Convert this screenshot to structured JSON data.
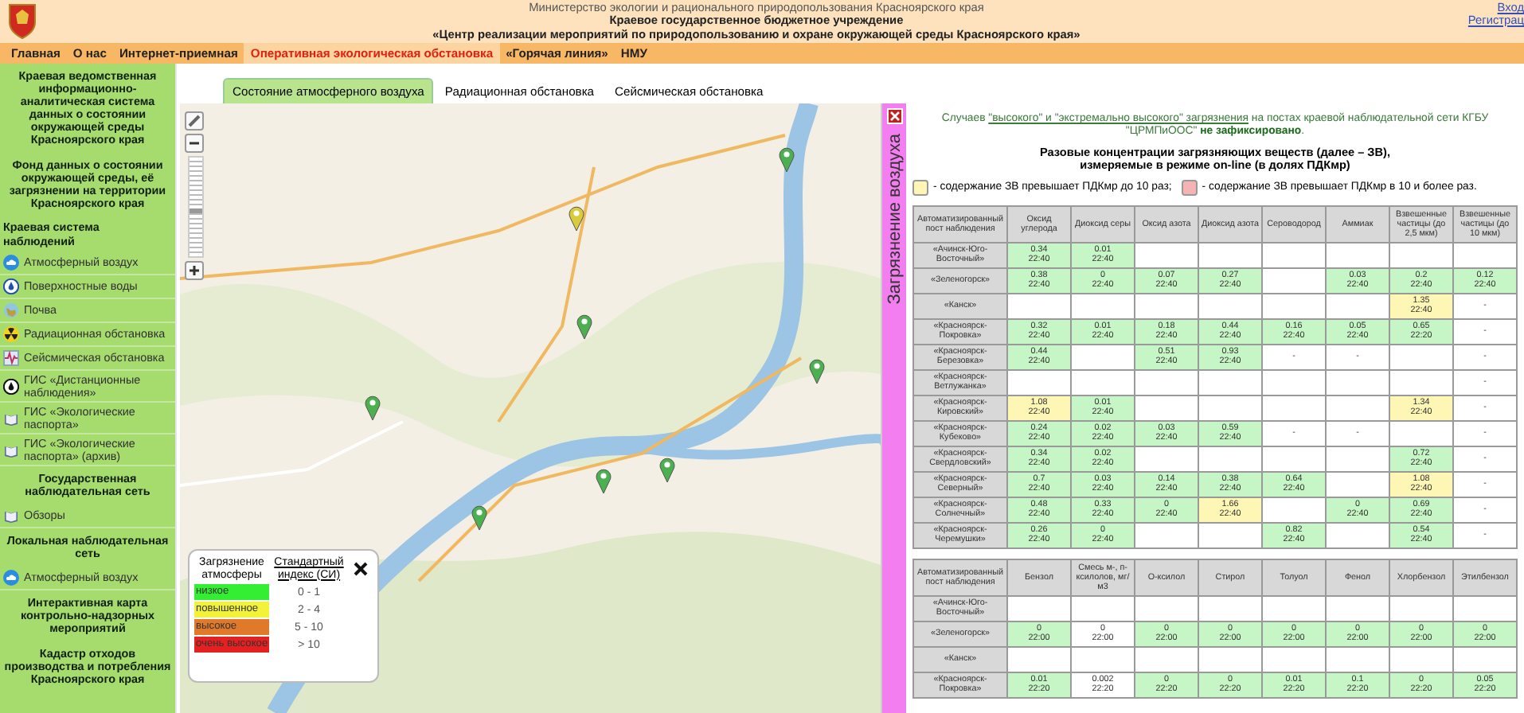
{
  "header": {
    "lines": [
      "Министерство экологии и рационального природопользования Красноярского края",
      "Краевое государственное бюджетное учреждение",
      "«Центр реализации мероприятий по природопользованию и охране окружающей среды Красноярского края»"
    ],
    "auth_links": [
      "Вход",
      "Регистрац"
    ]
  },
  "nav": [
    {
      "label": "Главная",
      "selected": false
    },
    {
      "label": "О нас",
      "selected": false
    },
    {
      "label": "Интернет-приемная",
      "selected": false
    },
    {
      "label": "Оперативная экологическая обстановка",
      "selected": true
    },
    {
      "label": "«Горячая линия»",
      "selected": false
    },
    {
      "label": "НМУ",
      "selected": false
    }
  ],
  "sidebar": [
    {
      "kind": "block",
      "text": "Краевая ведомственная информационно-аналитическая система данных о состоянии окружающей среды Красноярского края"
    },
    {
      "kind": "block",
      "text": "Фонд данных о состоянии окружающей среды, её загрязнении на территории Красноярского края"
    },
    {
      "kind": "group",
      "text": "Краевая система наблюдений"
    },
    {
      "kind": "link",
      "text": "Атмосферный воздух"
    },
    {
      "kind": "link",
      "text": "Поверхностные воды"
    },
    {
      "kind": "link",
      "text": "Почва"
    },
    {
      "kind": "link",
      "text": "Радиационная обстановка"
    },
    {
      "kind": "link",
      "text": "Сейсмическая обстановка"
    },
    {
      "kind": "link",
      "text": "ГИС «Дистанционные наблюдения»"
    },
    {
      "kind": "link",
      "text": "ГИС «Экологические паспорта»"
    },
    {
      "kind": "link",
      "text": "ГИС «Экологические паспорта» (архив)"
    },
    {
      "kind": "block",
      "text": "Государственная наблюдательная сеть"
    },
    {
      "kind": "link",
      "text": "Обзоры"
    },
    {
      "kind": "block",
      "text": "Локальная наблюдательная сеть"
    },
    {
      "kind": "link",
      "text": "Атмосферный воздух"
    },
    {
      "kind": "block",
      "text": "Интерактивная карта контрольно-надзорных мероприятий"
    },
    {
      "kind": "block",
      "text": "Кадастр отходов производства и потребления Красноярского края"
    }
  ],
  "tabs": [
    {
      "label": "Состояние атмосферного воздуха",
      "selected": true
    },
    {
      "label": "Радиационная обстановка",
      "selected": false
    },
    {
      "label": "Сейсмическая обстановка",
      "selected": false
    }
  ],
  "map": {
    "zoom": {
      "level": 0.45
    },
    "markers": [
      {
        "color": "#4caf50"
      },
      {
        "color": "#d8cc3c"
      },
      {
        "color": "#4caf50"
      },
      {
        "color": "#4caf50"
      },
      {
        "color": "#4caf50"
      },
      {
        "color": "#4caf50"
      },
      {
        "color": "#4caf50"
      },
      {
        "color": "#4caf50"
      }
    ],
    "legend": {
      "headers": [
        "Загрязнение атмосферы",
        "Стандартный индекс (СИ)"
      ],
      "rows": [
        {
          "label": "низкое",
          "range": "0 - 1",
          "color": "#33ee33"
        },
        {
          "label": "повышенное",
          "range": "2 - 4",
          "color": "#f2f23a"
        },
        {
          "label": "высокое",
          "range": "5 - 10",
          "color": "#e07a2a"
        },
        {
          "label": "очень высокое",
          "range": "> 10",
          "color": "#e52020"
        }
      ]
    }
  },
  "panel": {
    "title": "Загрязнение воздуха",
    "notice": {
      "prefix": "Случаев ",
      "link": "\"высокого\" и \"экстремально высокого\" загрязнения",
      "suffix": " на постах краевой наблюдательной сети КГБУ \"ЦРМПиООС\" **не зафиксировано**."
    },
    "heading": [
      "Разовые концентрации загрязняющих веществ (далее – ЗВ),",
      "измеряемые в режиме on-line (в долях ПДКмр)"
    ],
    "key": [
      {
        "text": "- содержание ЗВ превышает ПДКмр до 10 раз;",
        "color": "#fdf6b4"
      },
      {
        "text": "- содержание ЗВ превышает ПДКмр в 10 и более раз.",
        "color": "#f4b4b4"
      }
    ],
    "tables": [
      {
        "columns": [
          "Автоматизированный пост наблюдения",
          "Оксид углерода",
          "Диоксид серы",
          "Оксид азота",
          "Диоксид азота",
          "Сероводород",
          "Аммиак",
          "Взвешенные частицы (до 2,5 мкм)",
          "Взвешенные частицы (до 10 мкм)"
        ],
        "rows": [
          {
            "cells": [
              {
                "value": "«Ачинск-Юго-Восточный»"
              },
              {
                "value": "0.34",
                "time": "22:40",
                "color": "#c6f5c6"
              },
              {
                "value": "0.01",
                "time": "22:40",
                "color": "#c6f5c6"
              },
              "",
              "",
              "",
              "",
              "",
              ""
            ]
          },
          {
            "cells": [
              {
                "value": "«Зеленогорск»"
              },
              {
                "value": "0.38",
                "time": "22:40",
                "color": "#c6f5c6"
              },
              {
                "value": "0",
                "time": "22:40",
                "color": "#c6f5c6"
              },
              {
                "value": "0.07",
                "time": "22:40",
                "color": "#c6f5c6"
              },
              {
                "value": "0.27",
                "time": "22:40",
                "color": "#c6f5c6"
              },
              "",
              {
                "value": "0.03",
                "time": "22:40",
                "color": "#c6f5c6"
              },
              {
                "value": "0.2",
                "time": "22:40",
                "color": "#c6f5c6"
              },
              {
                "value": "0.12",
                "time": "22:40",
                "color": "#c6f5c6"
              }
            ]
          },
          {
            "cells": [
              {
                "value": "«Канск»"
              },
              "",
              "",
              "",
              "",
              "",
              "",
              {
                "value": "1.35",
                "time": "22:40",
                "color": "#fdf6b4"
              },
              {
                "value": "-",
                "color": "#ffffff"
              }
            ]
          },
          {
            "cells": [
              {
                "value": "«Красноярск-Покровка»"
              },
              {
                "value": "0.32",
                "time": "22:40",
                "color": "#c6f5c6"
              },
              {
                "value": "0.01",
                "time": "22:40",
                "color": "#c6f5c6"
              },
              {
                "value": "0.18",
                "time": "22:40",
                "color": "#c6f5c6"
              },
              {
                "value": "0.44",
                "time": "22:40",
                "color": "#c6f5c6"
              },
              {
                "value": "0.16",
                "time": "22:40",
                "color": "#c6f5c6"
              },
              {
                "value": "0.05",
                "time": "22:40",
                "color": "#c6f5c6"
              },
              {
                "value": "0.65",
                "time": "22:20",
                "color": "#c6f5c6"
              },
              {
                "value": "-",
                "color": "#ffffff"
              }
            ]
          },
          {
            "cells": [
              {
                "value": "«Красноярск-Березовка»"
              },
              {
                "value": "0.44",
                "time": "22:40",
                "color": "#c6f5c6"
              },
              "",
              {
                "value": "0.51",
                "time": "22:40",
                "color": "#c6f5c6"
              },
              {
                "value": "0.93",
                "time": "22:40",
                "color": "#c6f5c6"
              },
              {
                "value": "-",
                "color": "#ffffff"
              },
              {
                "value": "-",
                "color": "#ffffff"
              },
              "",
              {
                "value": "-",
                "color": "#ffffff"
              }
            ]
          },
          {
            "cells": [
              {
                "value": "«Красноярск-Ветлужанка»"
              },
              "",
              "",
              "",
              "",
              "",
              "",
              "",
              {
                "value": "-",
                "color": "#ffffff"
              }
            ]
          },
          {
            "cells": [
              {
                "value": "«Красноярск-Кировский»"
              },
              {
                "value": "1.08",
                "time": "22:40",
                "color": "#fdf6b4"
              },
              {
                "value": "0.01",
                "time": "22:40",
                "color": "#c6f5c6"
              },
              "",
              "",
              "",
              "",
              {
                "value": "1.34",
                "time": "22:40",
                "color": "#fdf6b4"
              },
              {
                "value": "-",
                "color": "#ffffff"
              }
            ]
          },
          {
            "cells": [
              {
                "value": "«Красноярск-Кубеково»"
              },
              {
                "value": "0.24",
                "time": "22:40",
                "color": "#c6f5c6"
              },
              {
                "value": "0.02",
                "time": "22:40",
                "color": "#c6f5c6"
              },
              {
                "value": "0.03",
                "time": "22:40",
                "color": "#c6f5c6"
              },
              {
                "value": "0.59",
                "time": "22:40",
                "color": "#c6f5c6"
              },
              {
                "value": "-",
                "color": "#ffffff"
              },
              {
                "value": "-",
                "color": "#ffffff"
              },
              "",
              {
                "value": "-",
                "color": "#ffffff"
              }
            ]
          },
          {
            "cells": [
              {
                "value": "«Красноярск-Свердловский»"
              },
              {
                "value": "0.34",
                "time": "22:40",
                "color": "#c6f5c6"
              },
              {
                "value": "0.02",
                "time": "22:40",
                "color": "#c6f5c6"
              },
              "",
              "",
              "",
              "",
              {
                "value": "0.72",
                "time": "22:40",
                "color": "#c6f5c6"
              },
              {
                "value": "-",
                "color": "#ffffff"
              }
            ]
          },
          {
            "cells": [
              {
                "value": "«Красноярск-Северный»"
              },
              {
                "value": "0.7",
                "time": "22:40",
                "color": "#c6f5c6"
              },
              {
                "value": "0.03",
                "time": "22:40",
                "color": "#c6f5c6"
              },
              {
                "value": "0.14",
                "time": "22:40",
                "color": "#c6f5c6"
              },
              {
                "value": "0.38",
                "time": "22:40",
                "color": "#c6f5c6"
              },
              {
                "value": "0.64",
                "time": "22:40",
                "color": "#c6f5c6"
              },
              "",
              {
                "value": "1.08",
                "time": "22:40",
                "color": "#fdf6b4"
              },
              {
                "value": "-",
                "color": "#ffffff"
              }
            ]
          },
          {
            "cells": [
              {
                "value": "«Красноярск-Солнечный»"
              },
              {
                "value": "0.48",
                "time": "22:40",
                "color": "#c6f5c6"
              },
              {
                "value": "0.33",
                "time": "22:40",
                "color": "#c6f5c6"
              },
              {
                "value": "0",
                "time": "22:40",
                "color": "#c6f5c6"
              },
              {
                "value": "1.66",
                "time": "22:40",
                "color": "#fdf6b4"
              },
              "",
              {
                "value": "0",
                "time": "22:40",
                "color": "#c6f5c6"
              },
              {
                "value": "0.69",
                "time": "22:40",
                "color": "#c6f5c6"
              },
              {
                "value": "-",
                "color": "#ffffff"
              }
            ]
          },
          {
            "cells": [
              {
                "value": "«Красноярск-Черемушки»"
              },
              {
                "value": "0.26",
                "time": "22:40",
                "color": "#c6f5c6"
              },
              {
                "value": "0",
                "time": "22:40",
                "color": "#c6f5c6"
              },
              "",
              "",
              {
                "value": "0.82",
                "time": "22:40",
                "color": "#c6f5c6"
              },
              "",
              {
                "value": "0.54",
                "time": "22:40",
                "color": "#c6f5c6"
              },
              {
                "value": "-",
                "color": "#ffffff"
              }
            ]
          }
        ]
      },
      {
        "columns": [
          "Автоматизированный пост наблюдения",
          "Бензол",
          "Смесь м-, п-ксилолов, мг/м3",
          "О-ксилол",
          "Стирол",
          "Толуол",
          "Фенол",
          "Хлорбензол",
          "Этилбензол"
        ],
        "rows": [
          {
            "cells": [
              {
                "value": "«Ачинск-Юго-Восточный»"
              },
              "",
              "",
              "",
              "",
              "",
              "",
              "",
              ""
            ]
          },
          {
            "cells": [
              {
                "value": "«Зеленогорск»"
              },
              {
                "value": "0",
                "time": "22:00",
                "color": "#c6f5c6"
              },
              {
                "value": "0",
                "time": "22:00",
                "color": "#ffffff"
              },
              {
                "value": "0",
                "time": "22:00",
                "color": "#c6f5c6"
              },
              {
                "value": "0",
                "time": "22:00",
                "color": "#c6f5c6"
              },
              {
                "value": "0",
                "time": "22:00",
                "color": "#c6f5c6"
              },
              {
                "value": "0",
                "time": "22:00",
                "color": "#c6f5c6"
              },
              {
                "value": "0",
                "time": "22:00",
                "color": "#c6f5c6"
              },
              {
                "value": "0",
                "time": "22:00",
                "color": "#c6f5c6"
              }
            ]
          },
          {
            "cells": [
              {
                "value": "«Канск»"
              },
              "",
              "",
              "",
              "",
              "",
              "",
              "",
              ""
            ]
          },
          {
            "cells": [
              {
                "value": "«Красноярск-Покровка»"
              },
              {
                "value": "0.01",
                "time": "22:20",
                "color": "#c6f5c6"
              },
              {
                "value": "0.002",
                "time": "22:20",
                "color": "#ffffff"
              },
              {
                "value": "0",
                "time": "22:20",
                "color": "#c6f5c6"
              },
              {
                "value": "0",
                "time": "22:20",
                "color": "#c6f5c6"
              },
              {
                "value": "0.01",
                "time": "22:20",
                "color": "#c6f5c6"
              },
              {
                "value": "0.1",
                "time": "22:20",
                "color": "#c6f5c6"
              },
              {
                "value": "0",
                "time": "22:20",
                "color": "#c6f5c6"
              },
              {
                "value": "0.05",
                "time": "22:20",
                "color": "#c6f5c6"
              }
            ]
          }
        ]
      }
    ]
  }
}
